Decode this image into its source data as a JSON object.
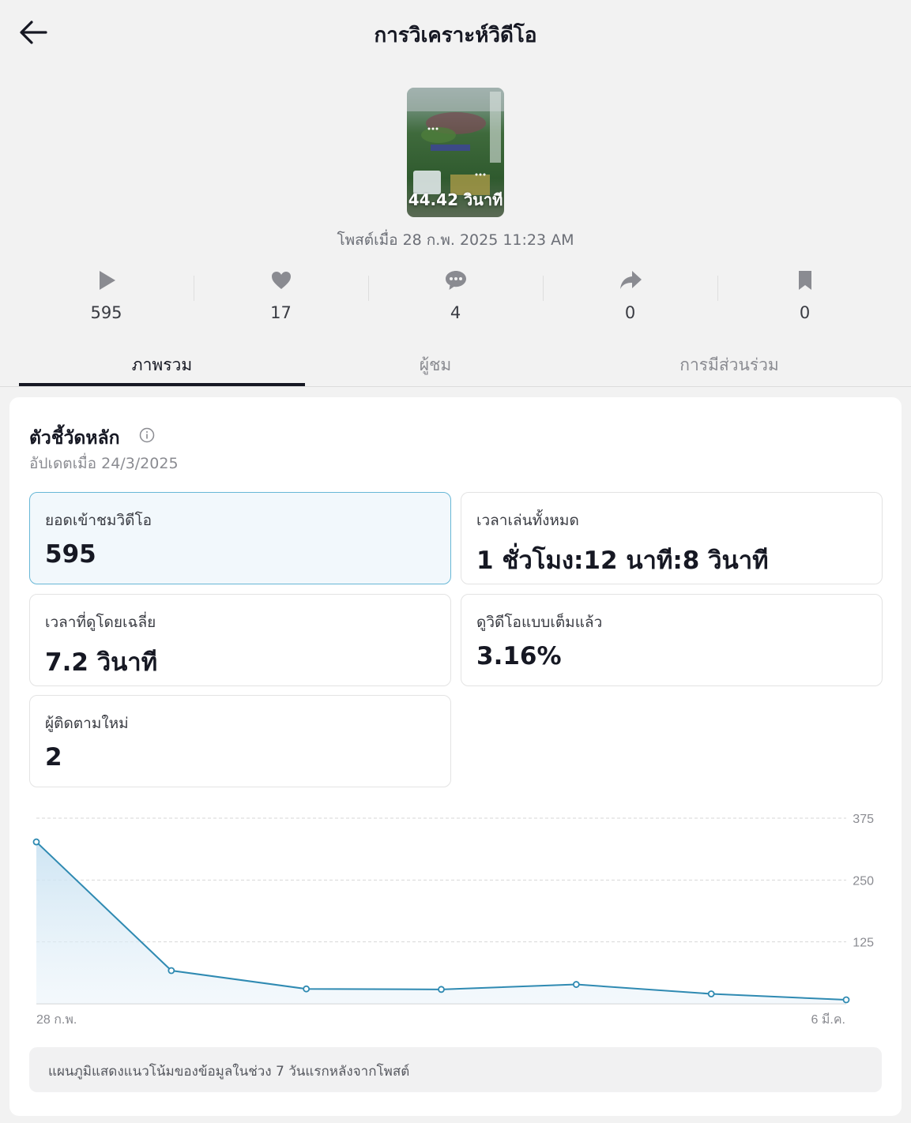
{
  "header": {
    "title": "การวิเคราะห์วิดีโอ",
    "back_icon": "arrow-left-icon"
  },
  "video": {
    "duration": "44.42 วินาที",
    "posted": "โพสต์เมื่อ 28 ก.พ. 2025 11:23 AM"
  },
  "stats": [
    {
      "icon": "play-icon",
      "value": "595"
    },
    {
      "icon": "heart-icon",
      "value": "17"
    },
    {
      "icon": "comment-icon",
      "value": "4"
    },
    {
      "icon": "share-icon",
      "value": "0"
    },
    {
      "icon": "bookmark-icon",
      "value": "0"
    }
  ],
  "tabs": [
    {
      "label": "ภาพรวม",
      "active": true
    },
    {
      "label": "ผู้ชม",
      "active": false
    },
    {
      "label": "การมีส่วนร่วม",
      "active": false
    }
  ],
  "key_metrics": {
    "title": "ตัวชี้วัดหลัก",
    "updated": "อัปเดตเมื่อ 24/3/2025",
    "items": [
      {
        "label": "ยอดเข้าชมวิดีโอ",
        "value": "595",
        "selected": true
      },
      {
        "label": "เวลาเล่นทั้งหมด",
        "value": "1 ชั่วโมง:12 นาที:8 วินาที"
      },
      {
        "label": "เวลาที่ดูโดยเฉลี่ย",
        "value": "7.2 วินาที"
      },
      {
        "label": "ดูวิดีโอแบบเต็มแล้ว",
        "value": "3.16%"
      },
      {
        "label": "ผู้ติดตามใหม่",
        "value": "2"
      }
    ]
  },
  "chart_data": {
    "type": "area",
    "x": [
      "28 ก.พ.",
      "1 มี.ค.",
      "2 มี.ค.",
      "3 มี.ค.",
      "4 มี.ค.",
      "5 มี.ค.",
      "6 มี.ค."
    ],
    "x_tick_labels": [
      "28 ก.พ.",
      "6 มี.ค."
    ],
    "values": [
      327,
      67,
      30,
      29,
      39,
      20,
      8
    ],
    "ylim": [
      0,
      375
    ],
    "y_ticks": [
      125,
      250,
      375
    ],
    "grid": true,
    "color": "#2f8ab2"
  },
  "caption": "แผนภูมิแสดงแนวโน้มของข้อมูลในช่วง 7 วันแรกหลังจากโพสต์"
}
